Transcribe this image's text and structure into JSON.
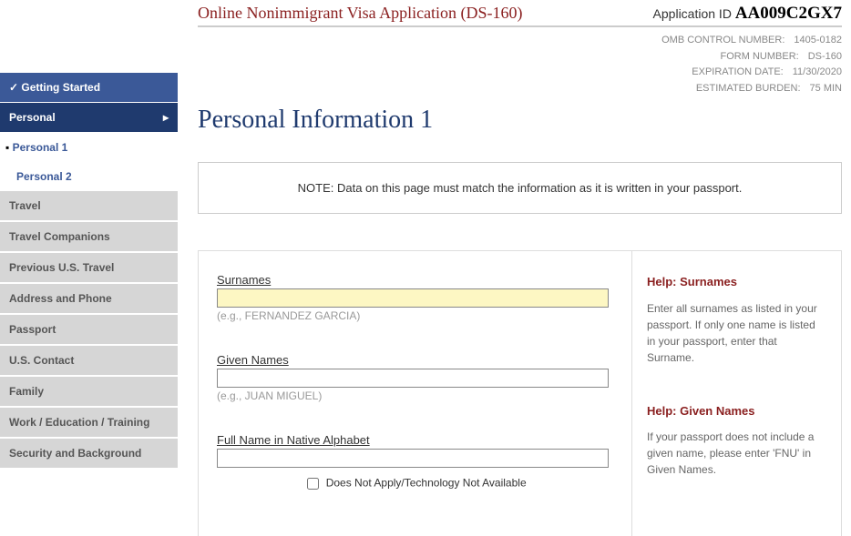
{
  "header": {
    "title": "Online Nonimmigrant Visa Application (DS-160)",
    "app_id_label": "Application ID ",
    "app_id_value": "AA009C2GX7"
  },
  "meta": {
    "omb_label": "OMB CONTROL NUMBER:",
    "omb_value": "1405-0182",
    "form_label": "FORM NUMBER:",
    "form_value": "DS-160",
    "exp_label": "EXPIRATION DATE:",
    "exp_value": "11/30/2020",
    "burden_label": "ESTIMATED BURDEN:",
    "burden_value": "75 MIN"
  },
  "page_heading": "Personal Information 1",
  "note": "NOTE: Data on this page must match the information as it is written in your passport.",
  "nav": {
    "getting_started": "Getting Started",
    "personal": "Personal",
    "personal1": "Personal 1",
    "personal2": "Personal 2",
    "travel": "Travel",
    "companions": "Travel Companions",
    "previous": "Previous U.S. Travel",
    "address": "Address and Phone",
    "passport": "Passport",
    "uscontact": "U.S. Contact",
    "family": "Family",
    "work": "Work / Education / Training",
    "security": "Security and Background"
  },
  "form": {
    "surnames_label": "Surnames",
    "surnames_value": "",
    "surnames_hint": "(e.g., FERNANDEZ GARCIA)",
    "given_label": "Given Names",
    "given_value": "",
    "given_hint": "(e.g., JUAN MIGUEL)",
    "native_label": "Full Name in Native Alphabet",
    "native_value": "",
    "na_label": "Does Not Apply/Technology Not Available"
  },
  "help": {
    "surnames_title": "Help: Surnames",
    "surnames_body": "Enter all surnames as listed in your passport. If only one name is listed in your passport, enter that Surname.",
    "given_title": "Help: Given Names",
    "given_body": "If your passport does not include a given name, please enter 'FNU' in Given Names."
  }
}
